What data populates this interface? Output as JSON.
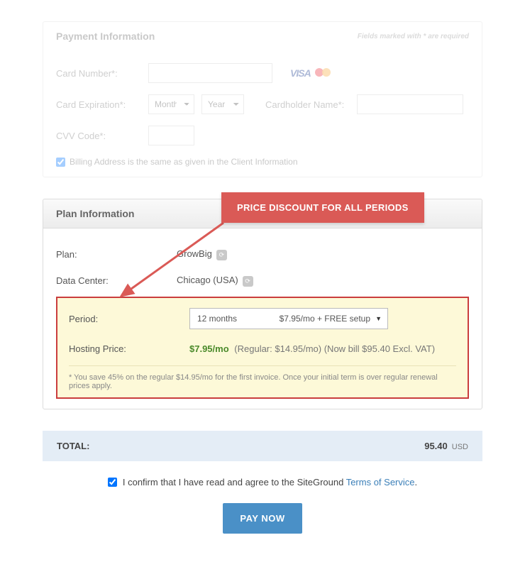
{
  "payment": {
    "title": "Payment Information",
    "required_note": "Fields marked with * are required",
    "card_number_label": "Card Number*:",
    "expiration_label": "Card Expiration*:",
    "month_ph": "Month",
    "year_ph": "Year",
    "cardholder_label": "Cardholder Name*:",
    "cvv_label": "CVV Code*:",
    "billing_same": "Billing Address is the same as given in the Client Information"
  },
  "callout": "PRICE DISCOUNT FOR ALL PERIODS",
  "plan": {
    "title": "Plan Information",
    "plan_label": "Plan:",
    "plan_value": "GrowBig",
    "dc_label": "Data Center:",
    "dc_value": "Chicago (USA)",
    "period_label": "Period:",
    "period_option_left": "12 months",
    "period_option_right": "$7.95/mo + FREE setup",
    "price_label": "Hosting Price:",
    "price_green": "$7.95/mo",
    "price_detail": "(Regular: $14.95/mo) (Now bill $95.40 Excl. VAT)",
    "save_note": "* You save 45% on the regular $14.95/mo for the first invoice. Once your initial term is over regular renewal prices apply."
  },
  "total": {
    "label": "TOTAL:",
    "amount": "95.40",
    "currency": "USD"
  },
  "confirm": {
    "text_before": "I confirm that I have read and agree to the SiteGround ",
    "link": "Terms of Service",
    "text_after": "."
  },
  "pay_button": "PAY NOW"
}
